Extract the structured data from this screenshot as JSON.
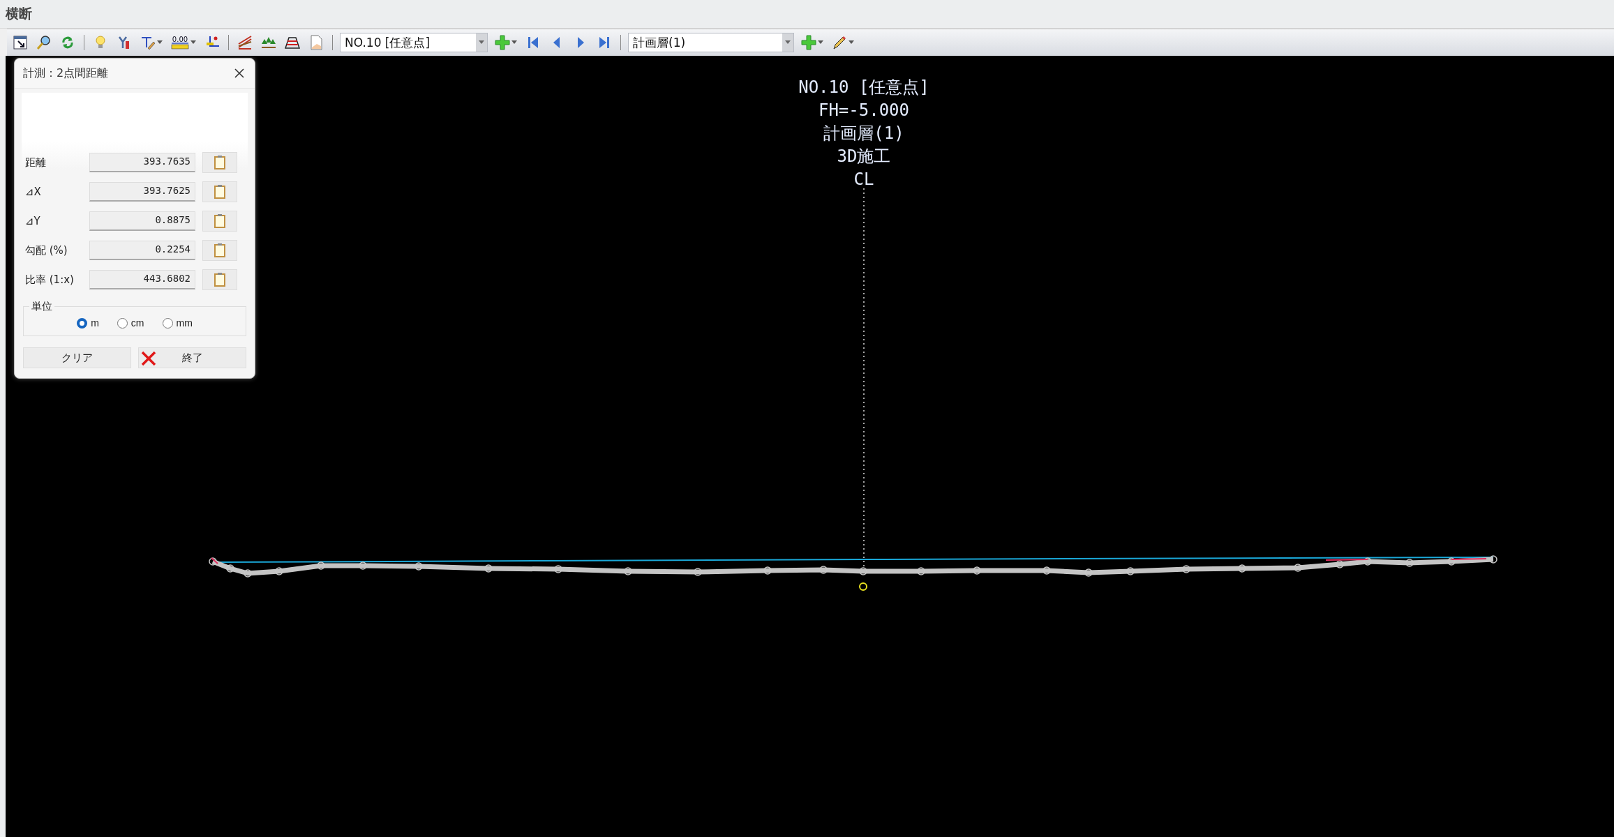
{
  "window": {
    "title": "横断"
  },
  "toolbar": {
    "ruler_label": "0.00",
    "station_select": {
      "value": "NO.10 [任意点]"
    },
    "layer_select": {
      "value": "計画層(1)"
    }
  },
  "dialog": {
    "title": "計測：2点間距離",
    "fields": [
      {
        "label": "距離",
        "value": "393.7635"
      },
      {
        "label": "⊿X",
        "value": "393.7625"
      },
      {
        "label": "⊿Y",
        "value": "0.8875"
      },
      {
        "label": "勾配 (%)",
        "value": "0.2254"
      },
      {
        "label": "比率 (1:x)",
        "value": "443.6802"
      }
    ],
    "unit_group": {
      "label": "単位",
      "options": [
        {
          "label": "m",
          "selected": true
        },
        {
          "label": "cm",
          "selected": false
        },
        {
          "label": "mm",
          "selected": false
        }
      ]
    },
    "buttons": [
      {
        "label": "クリア",
        "kind": "plain"
      },
      {
        "label": "終了",
        "kind": "close"
      }
    ]
  },
  "canvas": {
    "labels": [
      "NO.10 [任意点]",
      "FH=-5.000",
      "計画層(1)",
      "3D施工",
      "CL"
    ]
  }
}
